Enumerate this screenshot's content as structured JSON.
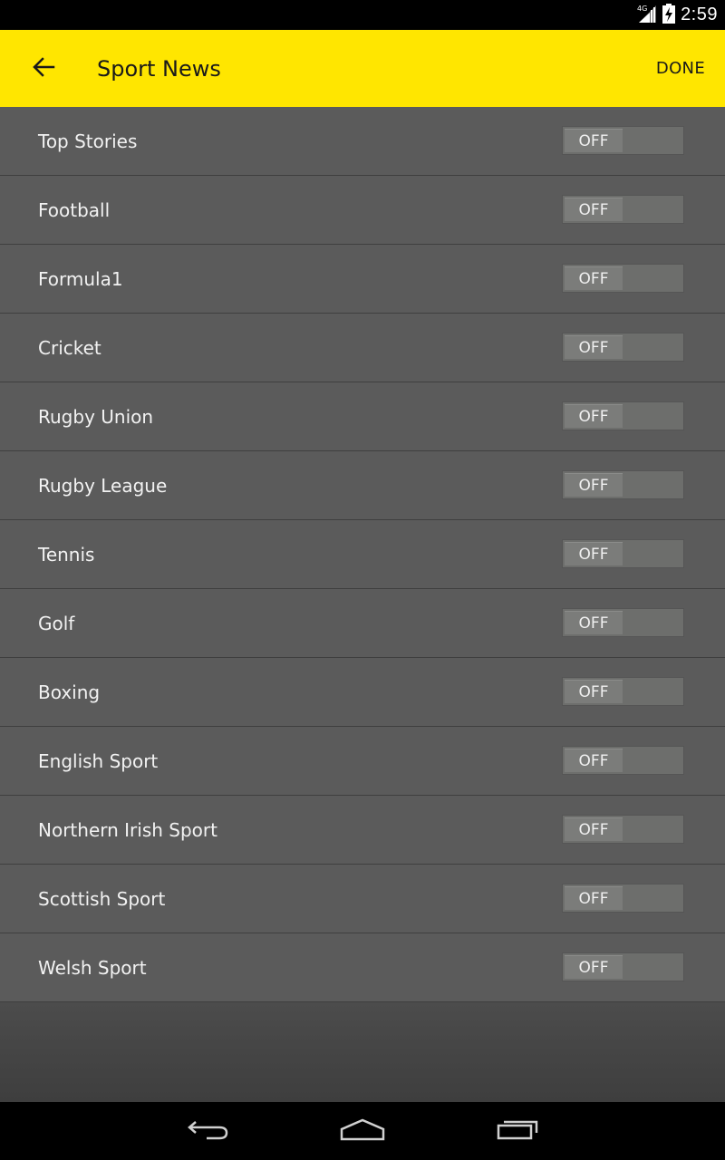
{
  "status_bar": {
    "network": "4G",
    "time": "2:59"
  },
  "app_bar": {
    "title": "Sport News",
    "done_label": "DONE",
    "back_icon": "arrow-left-icon"
  },
  "topics": [
    {
      "label": "Top Stories",
      "state": "OFF"
    },
    {
      "label": "Football",
      "state": "OFF"
    },
    {
      "label": "Formula1",
      "state": "OFF"
    },
    {
      "label": "Cricket",
      "state": "OFF"
    },
    {
      "label": "Rugby Union",
      "state": "OFF"
    },
    {
      "label": "Rugby League",
      "state": "OFF"
    },
    {
      "label": "Tennis",
      "state": "OFF"
    },
    {
      "label": "Golf",
      "state": "OFF"
    },
    {
      "label": "Boxing",
      "state": "OFF"
    },
    {
      "label": "English Sport",
      "state": "OFF"
    },
    {
      "label": "Northern Irish Sport",
      "state": "OFF"
    },
    {
      "label": "Scottish Sport",
      "state": "OFF"
    },
    {
      "label": "Welsh Sport",
      "state": "OFF"
    }
  ],
  "nav_bar": {
    "back": "back-icon",
    "home": "home-icon",
    "recents": "recent-apps-icon"
  },
  "colors": {
    "accent": "#ffe600",
    "list_background": "#5b5b5b",
    "toggle_track": "#6d6e6c"
  }
}
